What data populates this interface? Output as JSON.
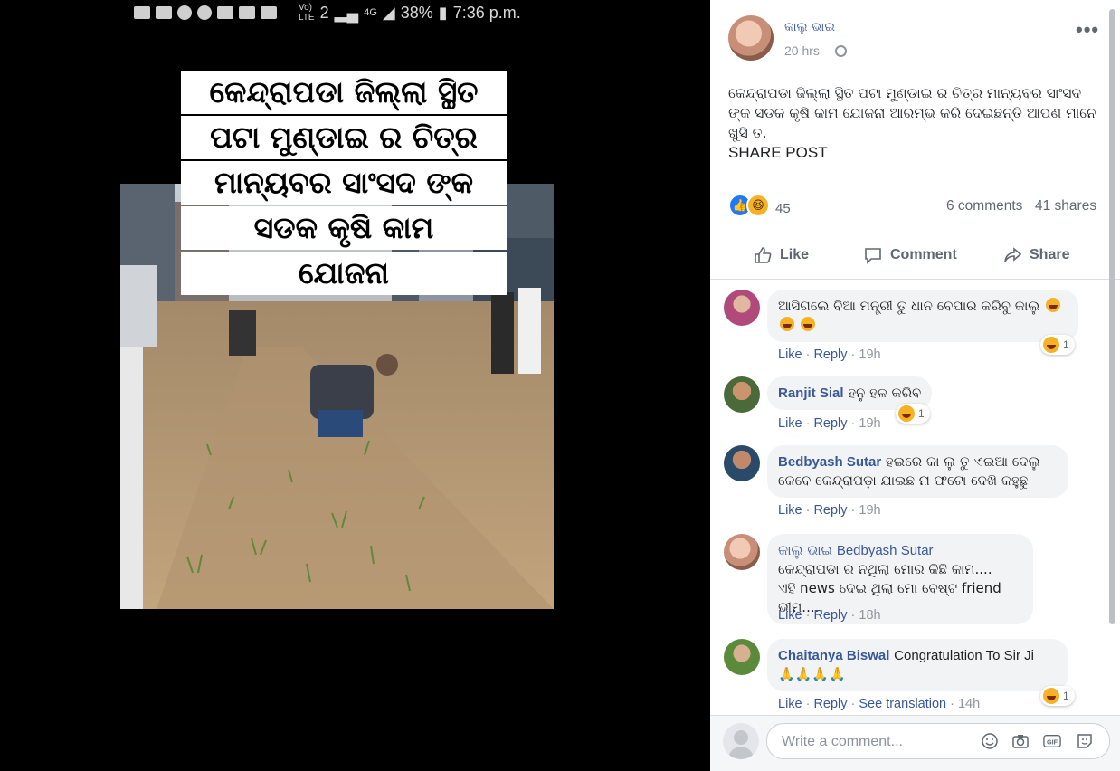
{
  "status_bar": {
    "network": "4G",
    "sim": "2",
    "battery": "38%",
    "time": "7:36 p.m."
  },
  "image_caption": [
    "କେନ୍ଦ୍ରାପଡା ଜିଲ୍ଲା ସ୍ଥିତ",
    "ପଟା ମୁଣ୍ଡାଇ ର ଚିତ୍ର",
    "ମାନ୍ୟବର ସାଂସଦ ଙ୍କ",
    "ସଡକ କୃଷି କାମ",
    "ଯୋଜନା"
  ],
  "post": {
    "author": "କାଲୁ ଭାଇ",
    "time": "20 hrs",
    "text": "କେନ୍ଦ୍ରାପଡା ଜିଲ୍ଲା ସ୍ଥିତ ପଟା ମୁଣ୍ଡାଇ ର ଚିତ୍ର ମାନ୍ୟବର ସାଂସଦ ଙ୍କ ସଡକ କୃଷି କାମ ଯୋଜନା ଆରମ୍ଭ କରି ଦେଇଛନ୍ତି ଆପଣ ମାନେ ଖୁସି ତ.",
    "share_text": "SHARE POST",
    "reaction_count": "45",
    "comments_count": "6 comments",
    "shares_count": "41 shares"
  },
  "actions": {
    "like": "Like",
    "comment": "Comment",
    "share": "Share"
  },
  "comments": [
    {
      "name": "",
      "text": "ଆସିଗଲେ ବିଆ ମନ୍ତ୍ରୀ ତୁ ଧାନ ବେପାର କରିବୁ କାଲୁ",
      "like": "Like",
      "reply": "Reply",
      "time": "19h",
      "reactions": "1"
    },
    {
      "name": "Ranjit Sial",
      "text": "ହନୁ ହଳ କରିବ",
      "like": "Like",
      "reply": "Reply",
      "time": "19h",
      "reactions": "1"
    },
    {
      "name": "Bedbyash Sutar",
      "text": "ହଇରେ କା ଲୁ ତୁ ଏଇଆ ଦେଲୁ",
      "text2": "କେବେ କେନ୍ଦ୍ରାପଡ଼ା ଯାଇଛ ନା ଫଟୋ ଦେଖି କହୁଛୁ",
      "like": "Like",
      "reply": "Reply",
      "time": "19h"
    },
    {
      "name": "କାଲୁ ଭାଇ",
      "mention": "Bedbyash Sutar",
      "text": "କେନ୍ଦ୍ରାପଡା ର ନଥିଲା ମୋର କିଛି କାମ....",
      "text2": "ଏହି news ଦେଇ ଥିଲା ମୋ ବେଷ୍ଟ friend ଭୀମ.....",
      "like": "Like",
      "reply": "Reply",
      "time": "18h"
    },
    {
      "name": "Chaitanya Biswal",
      "text": "Congratulation To Sir Ji",
      "text2": "🙏🙏🙏🙏",
      "like": "Like",
      "reply": "Reply",
      "translate": "See translation",
      "time": "14h",
      "reactions": "1"
    }
  ],
  "write_comment": {
    "placeholder": "Write a comment..."
  },
  "colors": {
    "link": "#385898",
    "accent": "#2078f4",
    "haha": "#f7b125"
  }
}
